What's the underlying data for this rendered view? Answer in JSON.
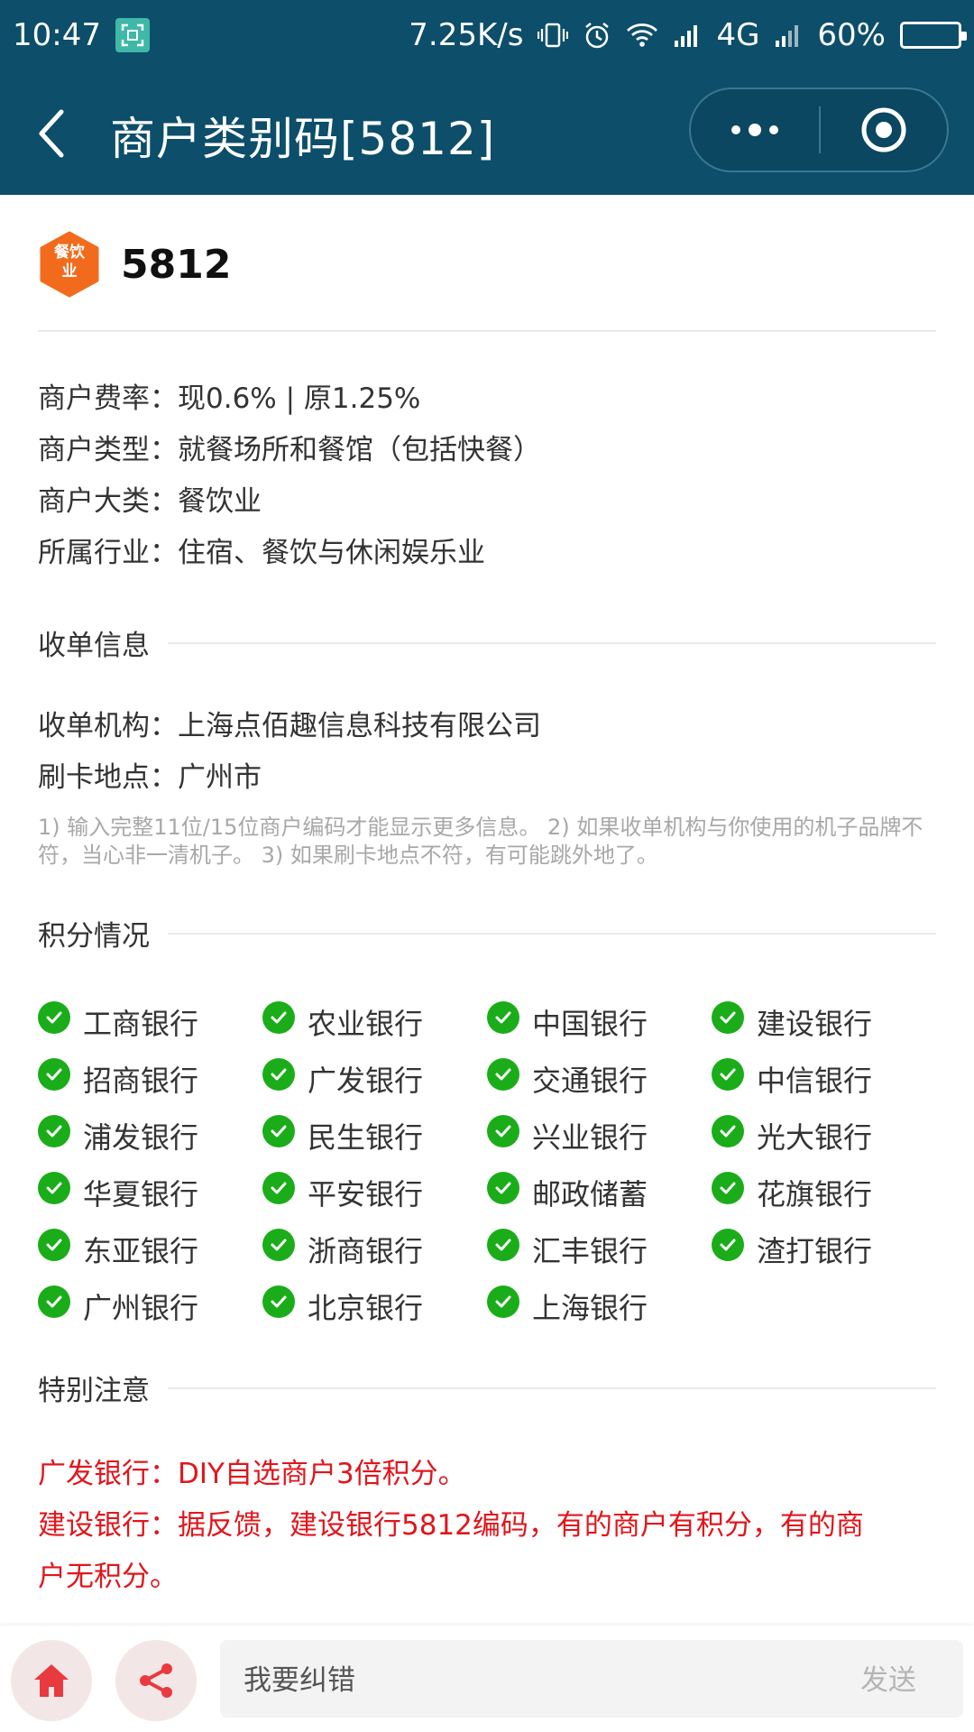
{
  "status_bar": {
    "time": "10:47",
    "net_speed": "7.25K/s",
    "network": "4G",
    "battery": "60%",
    "battery_level": 0.6
  },
  "nav": {
    "title": "商户类别码[5812]"
  },
  "merchant": {
    "badge_text": "餐饮业",
    "code": "5812",
    "info": [
      {
        "label": "商户费率：",
        "value": "现0.6% | 原1.25%"
      },
      {
        "label": "商户类型：",
        "value": "就餐场所和餐馆（包括快餐）"
      },
      {
        "label": "商户大类：",
        "value": "餐饮业"
      },
      {
        "label": "所属行业：",
        "value": "住宿、餐饮与休闲娱乐业"
      }
    ]
  },
  "acquiring": {
    "heading": "收单信息",
    "info": [
      {
        "label": "收单机构：",
        "value": "上海点佰趣信息科技有限公司"
      },
      {
        "label": "刷卡地点：",
        "value": "广州市"
      }
    ],
    "note": "1) 输入完整11位/15位商户编码才能显示更多信息。 2) 如果收单机构与你使用的机子品牌不符，当心非一清机子。 3) 如果刷卡地点不符，有可能跳外地了。"
  },
  "points": {
    "heading": "积分情况",
    "banks": [
      "工商银行",
      "农业银行",
      "中国银行",
      "建设银行",
      "招商银行",
      "广发银行",
      "交通银行",
      "中信银行",
      "浦发银行",
      "民生银行",
      "兴业银行",
      "光大银行",
      "华夏银行",
      "平安银行",
      "邮政储蓄",
      "花旗银行",
      "东亚银行",
      "浙商银行",
      "汇丰银行",
      "渣打银行",
      "广州银行",
      "北京银行",
      "上海银行"
    ]
  },
  "special": {
    "heading": "特别注意",
    "lines": [
      "广发银行：DIY自选商户3倍积分。",
      "建设银行：据反馈，建设银行5812编码，有的商户有积分，有的商",
      "户无积分。"
    ]
  },
  "bottom": {
    "input_placeholder": "我要纠错",
    "send_label": "发送"
  },
  "colors": {
    "nav_bg": "#0d4e6a",
    "check_green": "#1aad19",
    "warn_red": "#e0161c",
    "badge_orange": "#f26b1d"
  }
}
